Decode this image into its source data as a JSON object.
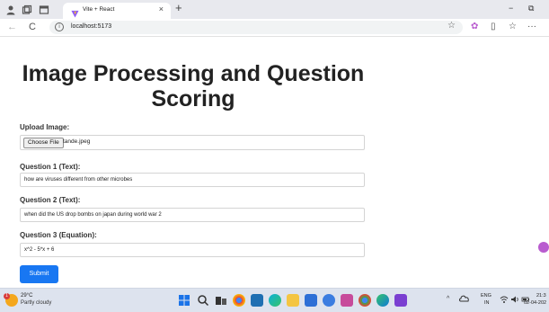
{
  "browser": {
    "tab_title": "Vite + React",
    "tab_close": "×",
    "new_tab": "+",
    "url": "localhost:5173",
    "info_glyph": "i",
    "star_glyph": "☆",
    "back_glyph": "←",
    "reload_glyph": "C",
    "minimize_glyph": "−",
    "restore_glyph": "⧉",
    "more_glyph": "···",
    "collections_glyph": "✿",
    "favorites_glyph": "☆",
    "split_glyph": "▯",
    "copilot_color": "#b95ccf"
  },
  "page": {
    "heading": "Image Processing and Question Scoring",
    "upload_label": "Upload Image:",
    "choose_file_label": "Choose File",
    "file_name": "tande.jpeg",
    "q1_label": "Question 1 (Text):",
    "q1_value": "how are viruses different from other microbes",
    "q2_label": "Question 2 (Text):",
    "q2_value": "when did the US drop bombs on japan during world war 2",
    "q3_label": "Question 3 (Equation):",
    "q3_value": "x^2 - 5*x + 6",
    "submit_label": "Submit",
    "accent_color": "#1877f2"
  },
  "taskbar": {
    "temperature": "29°C",
    "condition": "Partly cloudy",
    "weather_badge": "1",
    "lang_line1": "ENG",
    "lang_line2": "IN",
    "time": "21:3",
    "date": "02-04-202",
    "tray_chevron": "^",
    "icons": [
      "windows-start-icon",
      "search-icon",
      "task-view-icon",
      "chrome-icon",
      "vscode-icon",
      "edge-icon",
      "file-explorer-icon",
      "store-icon",
      "mail-icon",
      "photos-icon",
      "chrome-icon",
      "edge-profile-icon",
      "vscode-icon"
    ]
  }
}
